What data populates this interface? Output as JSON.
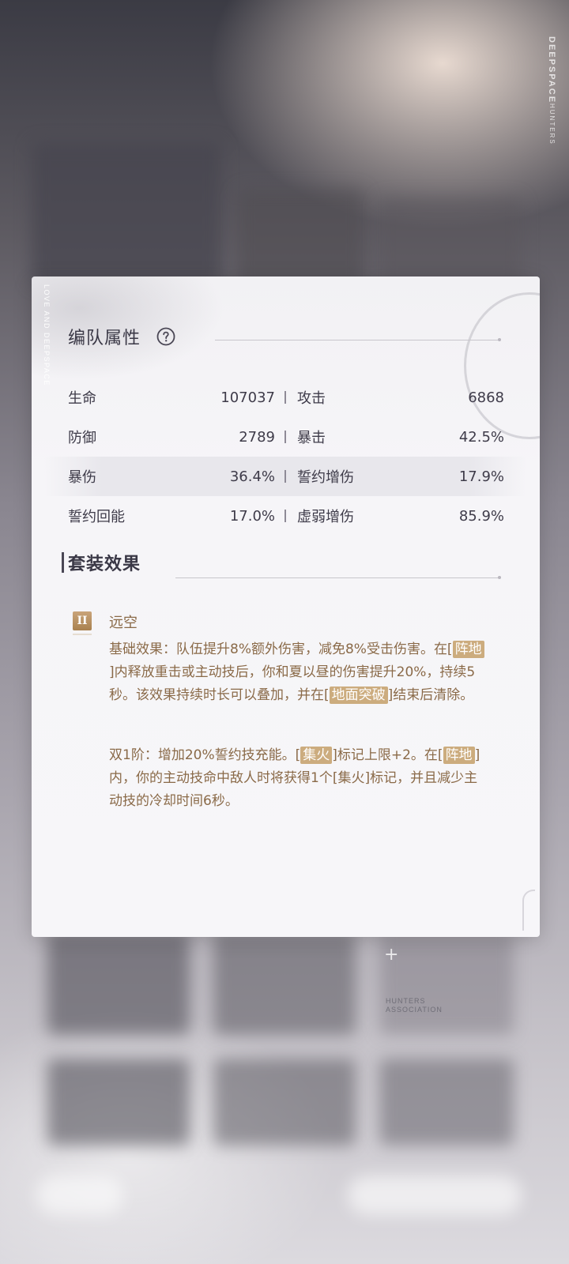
{
  "background": {
    "vertical_brand": "DEEPSPACE",
    "vertical_brand_sub": "HUNTERS",
    "tag_left": "HUNTERS",
    "tag_left2": "ASSOCIATION",
    "plus": "+"
  },
  "panel": {
    "vertical_deco": "LOVE AND DEEPSPACE",
    "team_section": {
      "title": "编队属性",
      "stats": [
        {
          "left_label": "生命",
          "left_value": "107037",
          "right_label": "攻击",
          "right_value": "6868"
        },
        {
          "left_label": "防御",
          "left_value": "2789",
          "right_label": "暴击",
          "right_value": "42.5%"
        },
        {
          "left_label": "暴伤",
          "left_value": "36.4%",
          "right_label": "誓约增伤",
          "right_value": "17.9%"
        },
        {
          "left_label": "誓约回能",
          "left_value": "17.0%",
          "right_label": "虚弱增伤",
          "right_value": "85.9%"
        }
      ]
    },
    "set_section": {
      "title": "套装效果",
      "badge": "II",
      "set_name": "远空",
      "base_effect": {
        "t1": "基础效果：队伍提升8%额外伤害，减免8%受击伤害。在[",
        "k1": "阵地",
        "t2": "]内释放重击或主动技后，你和夏以昼的伤害提升20%，持续5秒。该效果持续时长可以叠加，并在[",
        "k2": "地面突破",
        "t3": "]结束后清除。"
      },
      "tier_effect": {
        "t1": "双1阶：增加20%誓约技充能。[",
        "k1": "集火",
        "t2": "]标记上限+2。在[",
        "k2": "阵地",
        "t3": "]内，你的主动技命中敌人时将获得1个[集火]标记，并且减少主动技的冷却时间6秒。"
      }
    }
  }
}
